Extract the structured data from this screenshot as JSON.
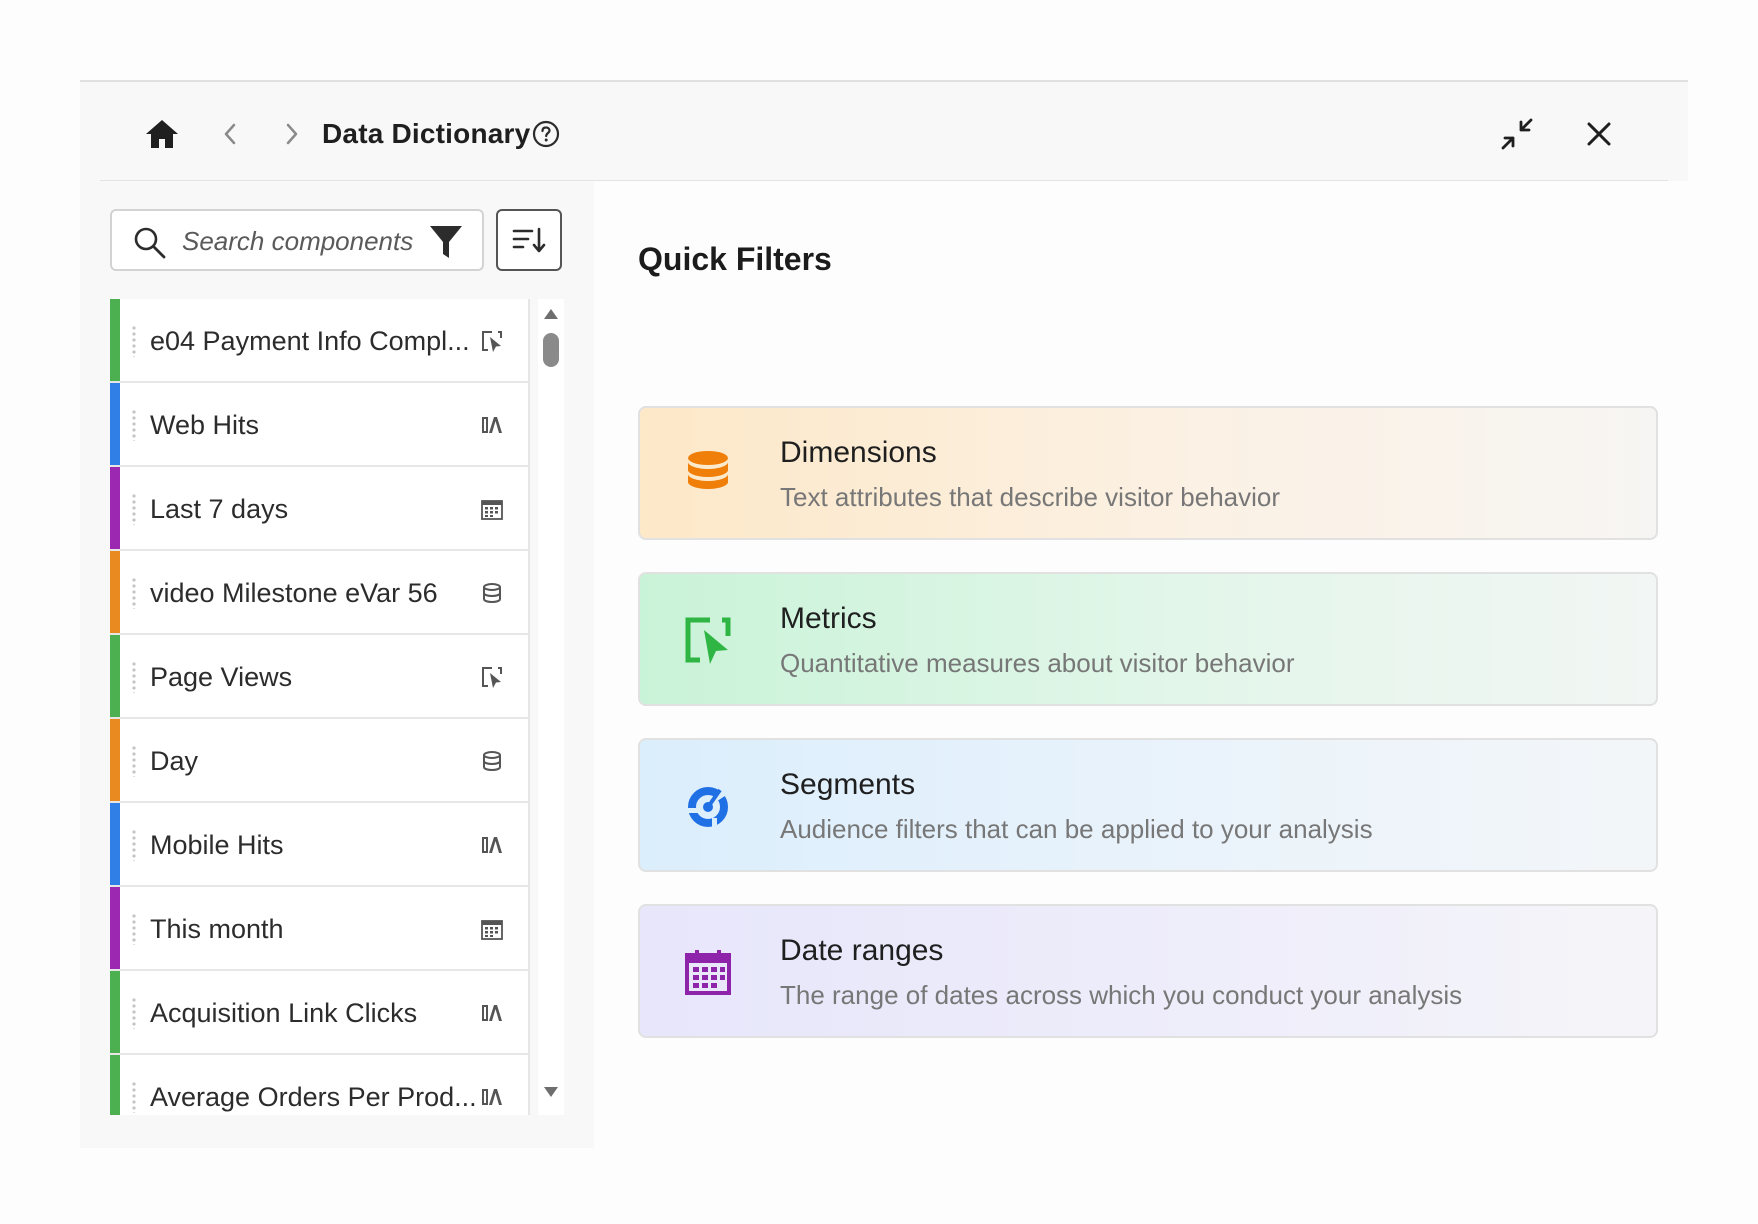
{
  "header": {
    "title": "Data Dictionary"
  },
  "search": {
    "placeholder": "Search components"
  },
  "components": [
    {
      "label": "e04 Payment Info Compl...",
      "type": "metric",
      "color": "#4caf50"
    },
    {
      "label": "Web Hits",
      "type": "calculated-metric",
      "color": "#2f7fe6"
    },
    {
      "label": "Last 7 days",
      "type": "date-range",
      "color": "#9c27b0"
    },
    {
      "label": "video Milestone eVar 56",
      "type": "dimension",
      "color": "#e88a20"
    },
    {
      "label": "Page Views",
      "type": "metric",
      "color": "#4caf50"
    },
    {
      "label": "Day",
      "type": "dimension",
      "color": "#e88a20"
    },
    {
      "label": "Mobile Hits",
      "type": "calculated-metric",
      "color": "#2f7fe6"
    },
    {
      "label": "This month",
      "type": "date-range",
      "color": "#9c27b0"
    },
    {
      "label": "Acquisition Link Clicks",
      "type": "calculated-metric",
      "color": "#4caf50"
    },
    {
      "label": "Average Orders Per Prod...",
      "type": "calculated-metric",
      "color": "#4caf50"
    }
  ],
  "quick_filters": {
    "title": "Quick Filters",
    "cards": [
      {
        "title": "Dimensions",
        "description": "Text attributes that describe visitor behavior",
        "icon": "database-icon",
        "color": "#f07f0a"
      },
      {
        "title": "Metrics",
        "description": "Quantitative measures about visitor behavior",
        "icon": "metric-cursor-icon",
        "color": "#2fb543"
      },
      {
        "title": "Segments",
        "description": "Audience filters that can be applied to your analysis",
        "icon": "segment-icon",
        "color": "#1f6fe5"
      },
      {
        "title": "Date ranges",
        "description": "The range of dates across which you conduct your analysis",
        "icon": "calendar-icon",
        "color": "#8e24aa"
      }
    ]
  }
}
